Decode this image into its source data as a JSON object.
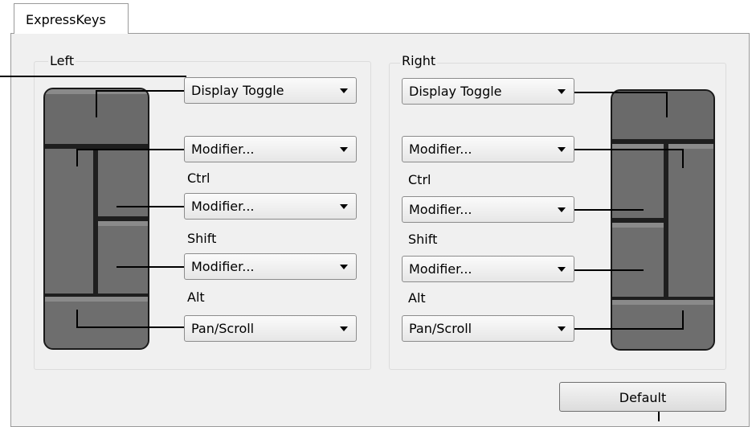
{
  "tab": {
    "label": "ExpressKeys"
  },
  "left": {
    "group_label": "Left",
    "keys": [
      {
        "value": "Display Toggle",
        "label": ""
      },
      {
        "value": "Modifier...",
        "label": "Ctrl"
      },
      {
        "value": "Modifier...",
        "label": "Shift"
      },
      {
        "value": "Modifier...",
        "label": "Alt"
      },
      {
        "value": "Pan/Scroll",
        "label": ""
      }
    ]
  },
  "right": {
    "group_label": "Right",
    "keys": [
      {
        "value": "Display Toggle",
        "label": ""
      },
      {
        "value": "Modifier...",
        "label": "Ctrl"
      },
      {
        "value": "Modifier...",
        "label": "Shift"
      },
      {
        "value": "Modifier...",
        "label": "Alt"
      },
      {
        "value": "Pan/Scroll",
        "label": ""
      }
    ]
  },
  "default_button": {
    "label": "Default"
  },
  "icons": {
    "dropdown": "chevron-down-icon"
  }
}
